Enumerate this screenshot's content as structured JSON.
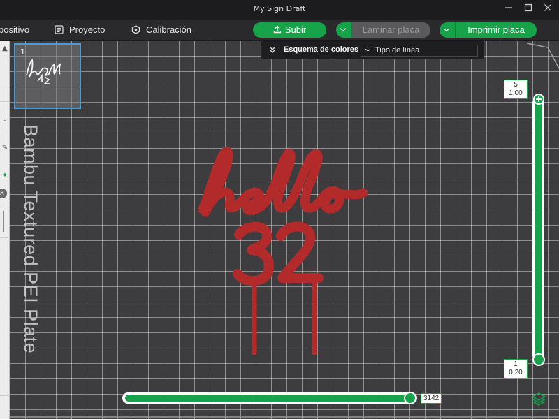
{
  "window": {
    "title": "My Sign Draft",
    "controls": [
      "minimize",
      "maximize",
      "close"
    ]
  },
  "toolbar": {
    "tabs": [
      {
        "label": "positivo",
        "icon": "device-icon"
      },
      {
        "label": "Proyecto",
        "icon": "project-icon"
      },
      {
        "label": "Calibración",
        "icon": "calibration-icon"
      }
    ],
    "upload_label": "Subir",
    "slice_label": "Laminar placa",
    "print_label": "Imprimir placa"
  },
  "color_scheme": {
    "title": "Esquema de colores",
    "selected": "Tipo de línea"
  },
  "plate": {
    "thumbnail_index": "1",
    "label": "Bambu Textured PEI Plate"
  },
  "model": {
    "line1": "hello",
    "line2": "32",
    "color": "#b22a2a"
  },
  "layer_slider": {
    "top_layer": "5",
    "top_height": "1,00",
    "bottom_layer": "1",
    "bottom_height": "0,20"
  },
  "move_slider": {
    "value": "3142"
  },
  "colors": {
    "accent": "#16a34a",
    "plate": "#3d3d40",
    "selection": "#4a9cd6"
  }
}
